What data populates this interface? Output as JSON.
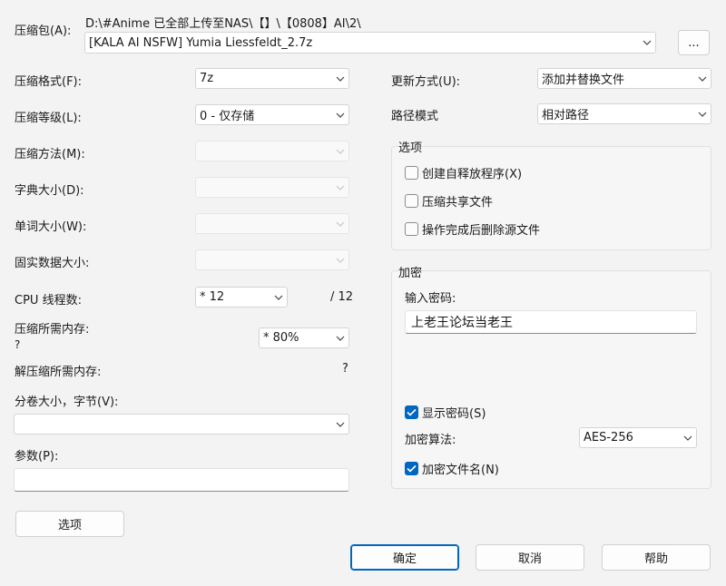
{
  "archive": {
    "label": "压缩包(A):",
    "path": "D:\\#Anime 已全部上传至NAS\\【】\\【0808】AI\\2\\",
    "filename": "[KALA AI NSFW] Yumia Liessfeldt_2.7z",
    "browse_label": "..."
  },
  "left": {
    "format_label": "压缩格式(F):",
    "format_value": "7z",
    "level_label": "压缩等级(L):",
    "level_value": "0 - 仅存储",
    "method_label": "压缩方法(M):",
    "dict_label": "字典大小(D):",
    "word_label": "单词大小(W):",
    "solid_label": "固实数据大小:",
    "threads_label": "CPU 线程数:",
    "threads_value": "* 12",
    "threads_max": "/ 12",
    "mem_compress_label": "压缩所需内存:",
    "mem_compress_value": "?",
    "mem_percent": "* 80%",
    "mem_decompress_label": "解压缩所需内存:",
    "mem_decompress_value": "?",
    "split_label": "分卷大小，字节(V):",
    "split_value": "",
    "params_label": "参数(P):",
    "params_value": "",
    "options_button": "选项"
  },
  "right": {
    "update_label": "更新方式(U):",
    "update_value": "添加并替换文件",
    "path_mode_label": "路径模式",
    "path_mode_value": "相对路径",
    "options_group_title": "选项",
    "opt_sfx": "创建自释放程序(X)",
    "opt_shared": "压缩共享文件",
    "opt_delete": "操作完成后删除源文件",
    "encryption_group_title": "加密",
    "password_label": "输入密码:",
    "password_value": "上老王论坛当老王",
    "show_password": "显示密码(S)",
    "enc_method_label": "加密算法:",
    "enc_method_value": "AES-256",
    "encrypt_names": "加密文件名(N)"
  },
  "footer": {
    "ok": "确定",
    "cancel": "取消",
    "help": "帮助"
  },
  "colors": {
    "accent": "#0067c0",
    "background": "#f3f3f3"
  }
}
